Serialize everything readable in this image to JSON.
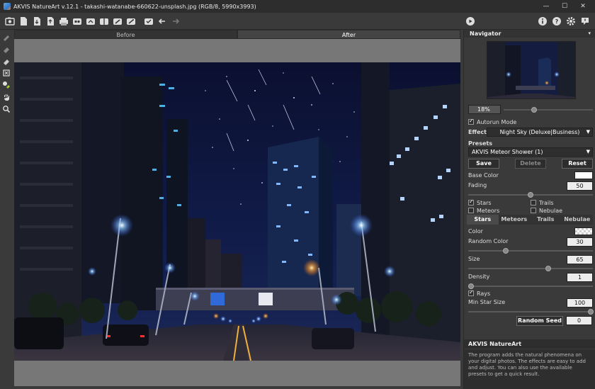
{
  "window": {
    "title": "AKVIS NatureArt v.12.1 - takashi-watanabe-660622-unsplash.jpg (RGB/8, 5990x3993)",
    "controls": [
      "—",
      "☐",
      "✕"
    ]
  },
  "toolbar": {
    "icons": [
      "open-icon",
      "new-icon",
      "save-icon",
      "export-icon",
      "print-icon",
      "batch-icon",
      "share-icon",
      "compare-icon",
      "brush-icon",
      "apply-icon",
      "undo-icon",
      "redo-icon"
    ],
    "right_icons": [
      "run-icon",
      "info-icon",
      "help-icon",
      "settings-icon",
      "notice-icon"
    ]
  },
  "tools": [
    "mask-tool-icon",
    "eraser-tool-icon",
    "erase-icon",
    "crop-icon",
    "pick-color-icon",
    "hand-icon",
    "zoom-icon"
  ],
  "view_tabs": {
    "before": "Before",
    "after": "After"
  },
  "navigator": {
    "title": "Navigator",
    "zoom": "18%",
    "zoom_fraction": 0.31
  },
  "settings": {
    "autorun_label": "Autorun Mode",
    "autorun_checked": true,
    "effect_label": "Effect:",
    "effect_value": "Night Sky (Deluxe|Business)",
    "presets_label": "Presets",
    "preset_value": "AKVIS Meteor Shower (1)",
    "save_label": "Save",
    "delete_label": "Delete",
    "reset_label": "Reset",
    "base_color_label": "Base Color",
    "base_color": "#ffffff",
    "fading_label": "Fading",
    "fading_value": "50",
    "fading_fraction": 0.5,
    "stars_label": "Stars",
    "stars_checked": true,
    "trails_label": "Trails",
    "trails_checked": false,
    "meteors_label": "Meteors",
    "meteors_checked": false,
    "nebulae_label": "Nebulae",
    "nebulae_checked": false,
    "subtabs": [
      "Stars",
      "Meteors",
      "Trails",
      "Nebulae"
    ],
    "color_label": "Color",
    "random_color_label": "Random Color",
    "random_color_value": "30",
    "random_color_fraction": 0.3,
    "size_label": "Size",
    "size_value": "65",
    "size_fraction": 0.65,
    "density_label": "Density",
    "density_value": "1",
    "density_fraction": 0.01,
    "rays_label": "Rays",
    "rays_checked": true,
    "min_star_size_label": "Min Star Size",
    "min_star_size_value": "100",
    "min_star_size_fraction": 1.0,
    "random_seed_label": "Random Seed",
    "random_seed_value": "0"
  },
  "help": {
    "title": "AKVIS NatureArt",
    "text": "The program adds the natural phenomena on your digital photos. The effects are easy to add and adjust. You can also use the available presets to get a quick result."
  }
}
